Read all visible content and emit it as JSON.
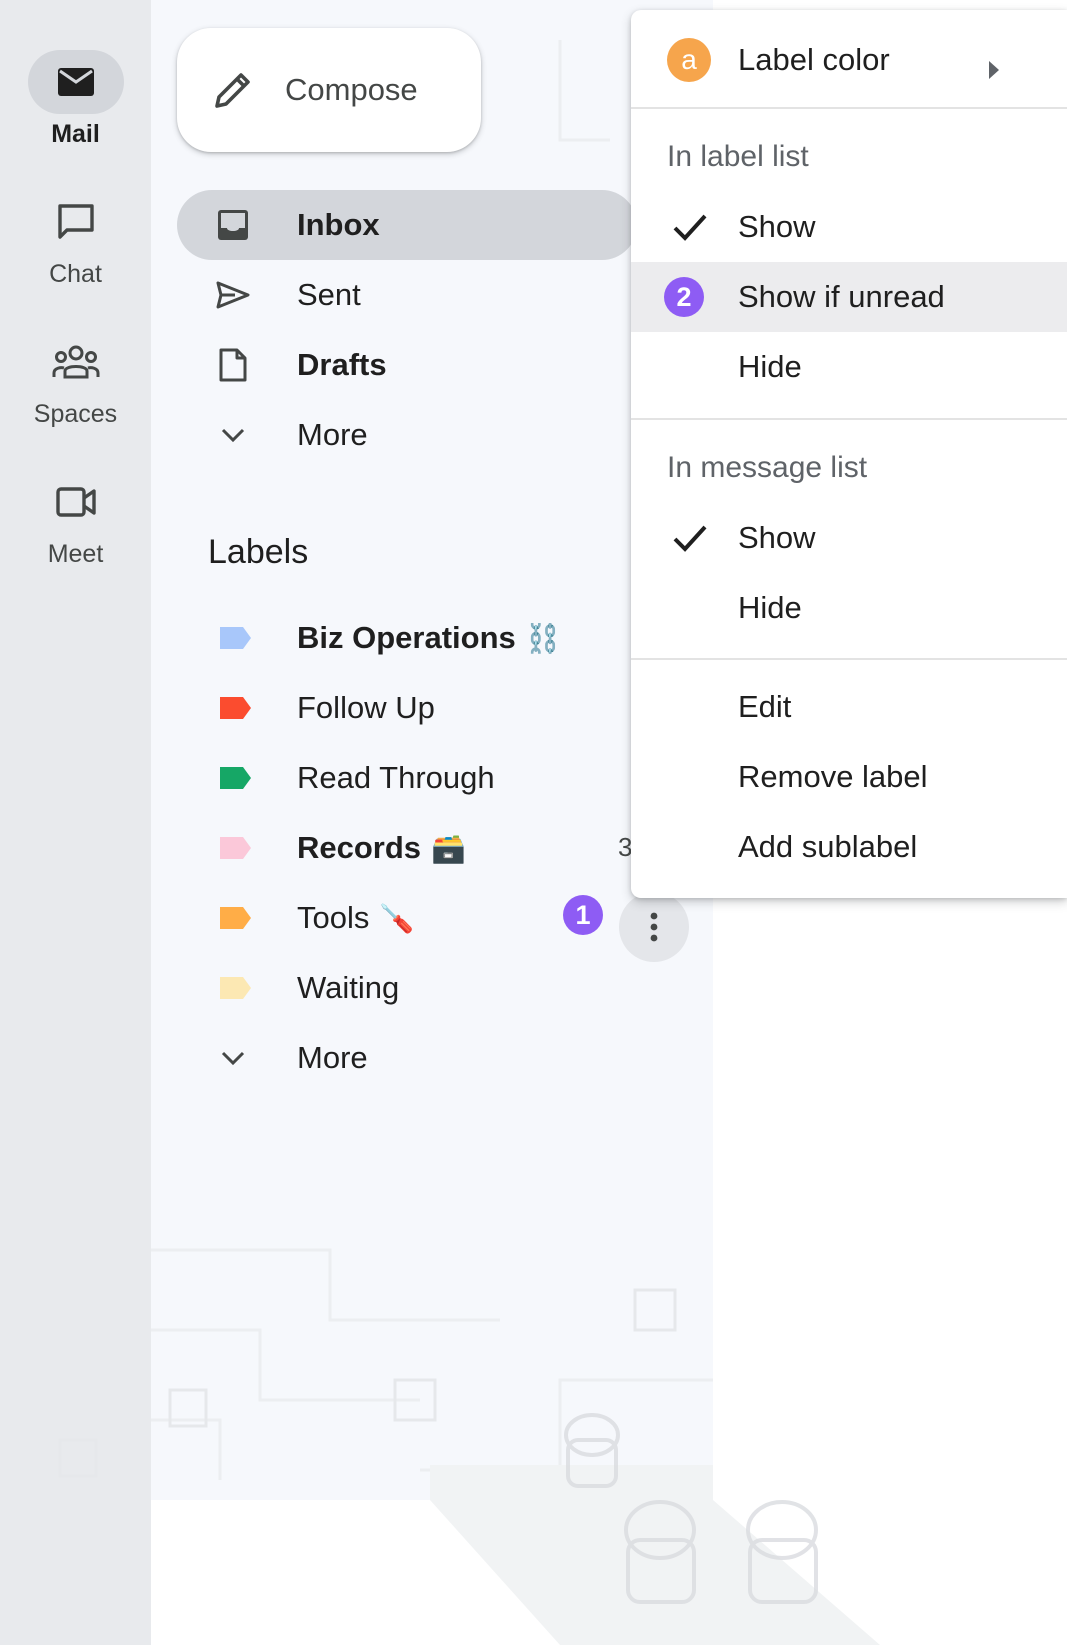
{
  "rail": {
    "items": [
      {
        "label": "Mail",
        "icon": "mail-icon",
        "active": true
      },
      {
        "label": "Chat",
        "icon": "chat-icon",
        "active": false
      },
      {
        "label": "Spaces",
        "icon": "spaces-icon",
        "active": false
      },
      {
        "label": "Meet",
        "icon": "meet-icon",
        "active": false
      }
    ]
  },
  "compose": {
    "label": "Compose",
    "icon": "pencil-icon"
  },
  "nav": {
    "inbox": "Inbox",
    "sent": "Sent",
    "drafts": "Drafts",
    "more": "More"
  },
  "labels": {
    "heading": "Labels",
    "items": [
      {
        "name": "Biz Operations",
        "emoji": "⛓️",
        "color": "#a8c7fa",
        "bold": true
      },
      {
        "name": "Follow Up",
        "emoji": "",
        "color": "#fb4c2f",
        "bold": false
      },
      {
        "name": "Read Through",
        "emoji": "",
        "color": "#16a766",
        "bold": false
      },
      {
        "name": "Records",
        "emoji": "🗃️",
        "color": "#fbc8d9",
        "bold": true,
        "count": "3"
      },
      {
        "name": "Tools",
        "emoji": "🪛",
        "color": "#ffad47",
        "bold": false
      },
      {
        "name": "Waiting",
        "emoji": "",
        "color": "#fce8b3",
        "bold": false
      }
    ],
    "more": "More"
  },
  "badges": {
    "step1": "1",
    "step2": "2",
    "accent": "#8e5cf4"
  },
  "menu": {
    "label_color": "Label color",
    "label_color_letter": "a",
    "in_label_list": "In label list",
    "label_list_show": "Show",
    "label_list_show_if_unread": "Show if unread",
    "label_list_hide": "Hide",
    "in_message_list": "In message list",
    "message_list_show": "Show",
    "message_list_hide": "Hide",
    "edit": "Edit",
    "remove_label": "Remove label",
    "add_sublabel": "Add sublabel"
  }
}
